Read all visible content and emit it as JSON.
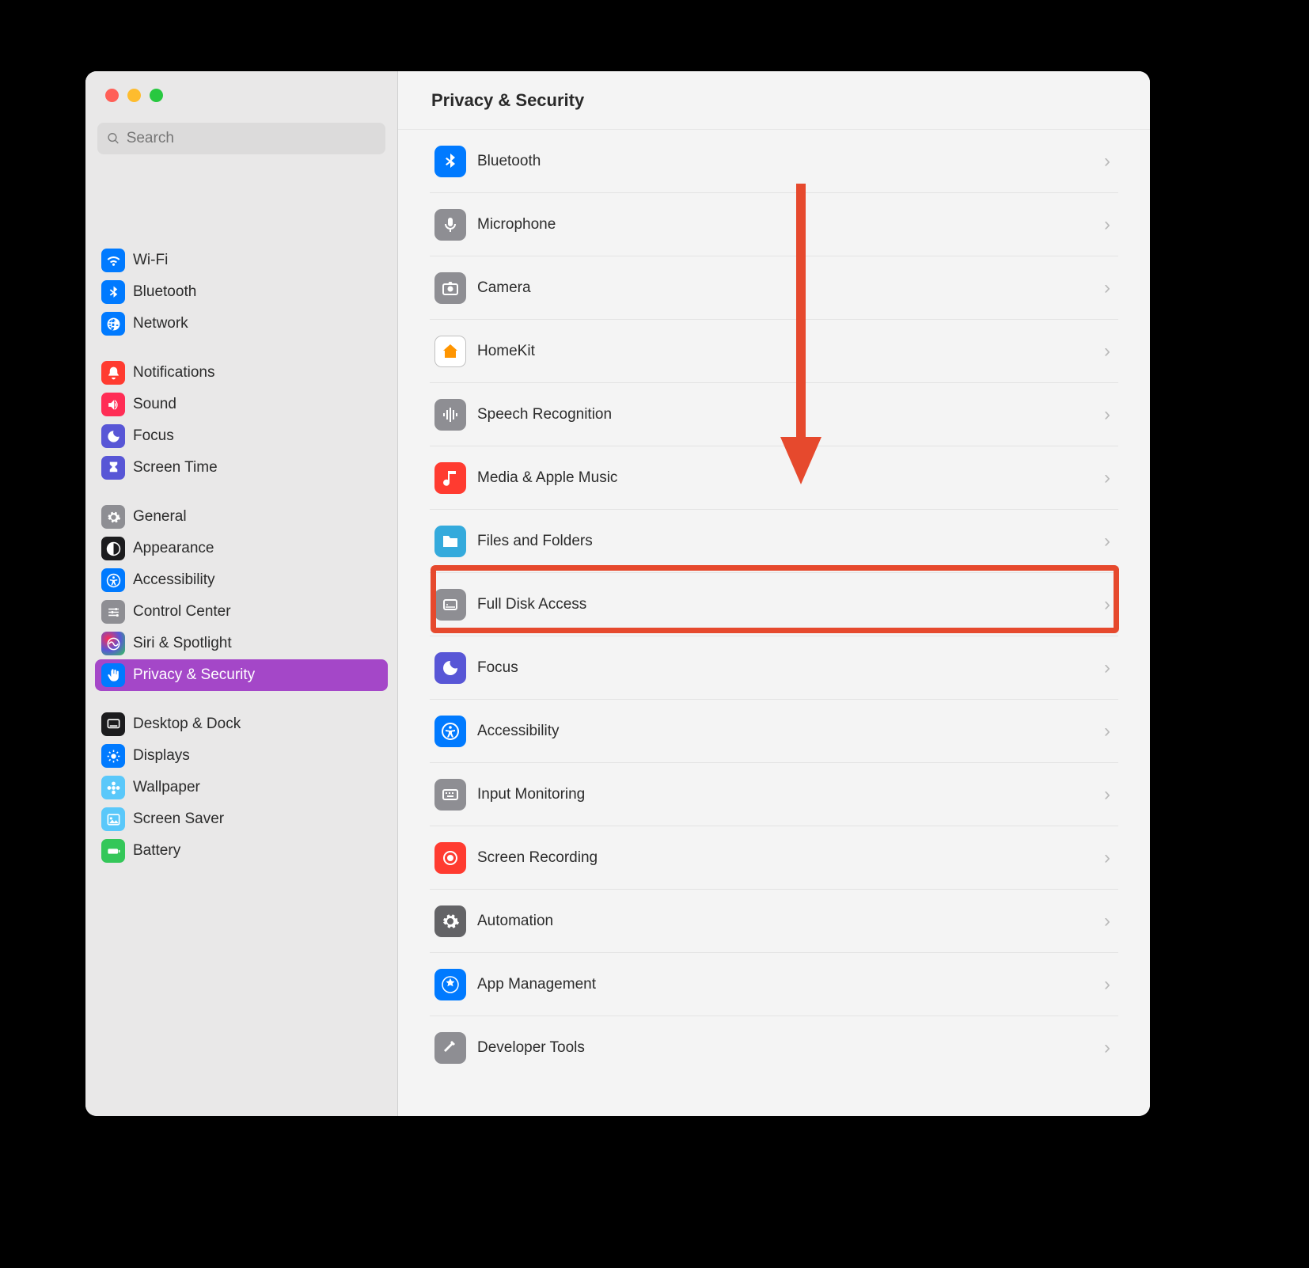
{
  "header": {
    "title": "Privacy & Security"
  },
  "search": {
    "placeholder": "Search"
  },
  "sidebar": {
    "groups": [
      {
        "items": [
          {
            "label": "Wi-Fi",
            "icon": "wifi",
            "bg": "bg-blue"
          },
          {
            "label": "Bluetooth",
            "icon": "bluetooth",
            "bg": "bg-blue"
          },
          {
            "label": "Network",
            "icon": "globe",
            "bg": "bg-blue"
          }
        ]
      },
      {
        "items": [
          {
            "label": "Notifications",
            "icon": "bell",
            "bg": "bg-red"
          },
          {
            "label": "Sound",
            "icon": "speaker",
            "bg": "bg-pink"
          },
          {
            "label": "Focus",
            "icon": "moon",
            "bg": "bg-purple"
          },
          {
            "label": "Screen Time",
            "icon": "hourglass",
            "bg": "bg-purple"
          }
        ]
      },
      {
        "items": [
          {
            "label": "General",
            "icon": "gear",
            "bg": "bg-gray"
          },
          {
            "label": "Appearance",
            "icon": "contrast",
            "bg": "bg-black"
          },
          {
            "label": "Accessibility",
            "icon": "accessibility",
            "bg": "bg-blue"
          },
          {
            "label": "Control Center",
            "icon": "sliders",
            "bg": "bg-gray"
          },
          {
            "label": "Siri & Spotlight",
            "icon": "siri",
            "bg": "bg-siri"
          },
          {
            "label": "Privacy & Security",
            "icon": "hand",
            "bg": "bg-blue",
            "selected": true
          }
        ]
      },
      {
        "items": [
          {
            "label": "Desktop & Dock",
            "icon": "dock",
            "bg": "bg-black"
          },
          {
            "label": "Displays",
            "icon": "sun",
            "bg": "bg-blue"
          },
          {
            "label": "Wallpaper",
            "icon": "flower",
            "bg": "bg-teal"
          },
          {
            "label": "Screen Saver",
            "icon": "image",
            "bg": "bg-teal"
          },
          {
            "label": "Battery",
            "icon": "battery",
            "bg": "bg-green"
          }
        ]
      }
    ]
  },
  "content": {
    "items": [
      {
        "label": "Bluetooth",
        "icon": "bluetooth",
        "bg": "bg-blue"
      },
      {
        "label": "Microphone",
        "icon": "mic",
        "bg": "bg-gray"
      },
      {
        "label": "Camera",
        "icon": "camera",
        "bg": "bg-gray"
      },
      {
        "label": "HomeKit",
        "icon": "home",
        "bg": "bg-white-bordered"
      },
      {
        "label": "Speech Recognition",
        "icon": "waveform",
        "bg": "bg-gray"
      },
      {
        "label": "Media & Apple Music",
        "icon": "music",
        "bg": "bg-red"
      },
      {
        "label": "Files and Folders",
        "icon": "folder",
        "bg": "bg-folder"
      },
      {
        "label": "Full Disk Access",
        "icon": "disk",
        "bg": "bg-gray",
        "highlighted": true
      },
      {
        "label": "Focus",
        "icon": "moon",
        "bg": "bg-purple"
      },
      {
        "label": "Accessibility",
        "icon": "accessibility",
        "bg": "bg-blue"
      },
      {
        "label": "Input Monitoring",
        "icon": "keyboard",
        "bg": "bg-gray"
      },
      {
        "label": "Screen Recording",
        "icon": "record",
        "bg": "bg-red"
      },
      {
        "label": "Automation",
        "icon": "gears",
        "bg": "bg-darkgray"
      },
      {
        "label": "App Management",
        "icon": "appstore",
        "bg": "bg-blue"
      },
      {
        "label": "Developer Tools",
        "icon": "hammer",
        "bg": "bg-gray"
      }
    ]
  },
  "annotation": {
    "arrow_color": "#e6492d",
    "highlighted_label": "Full Disk Access"
  }
}
